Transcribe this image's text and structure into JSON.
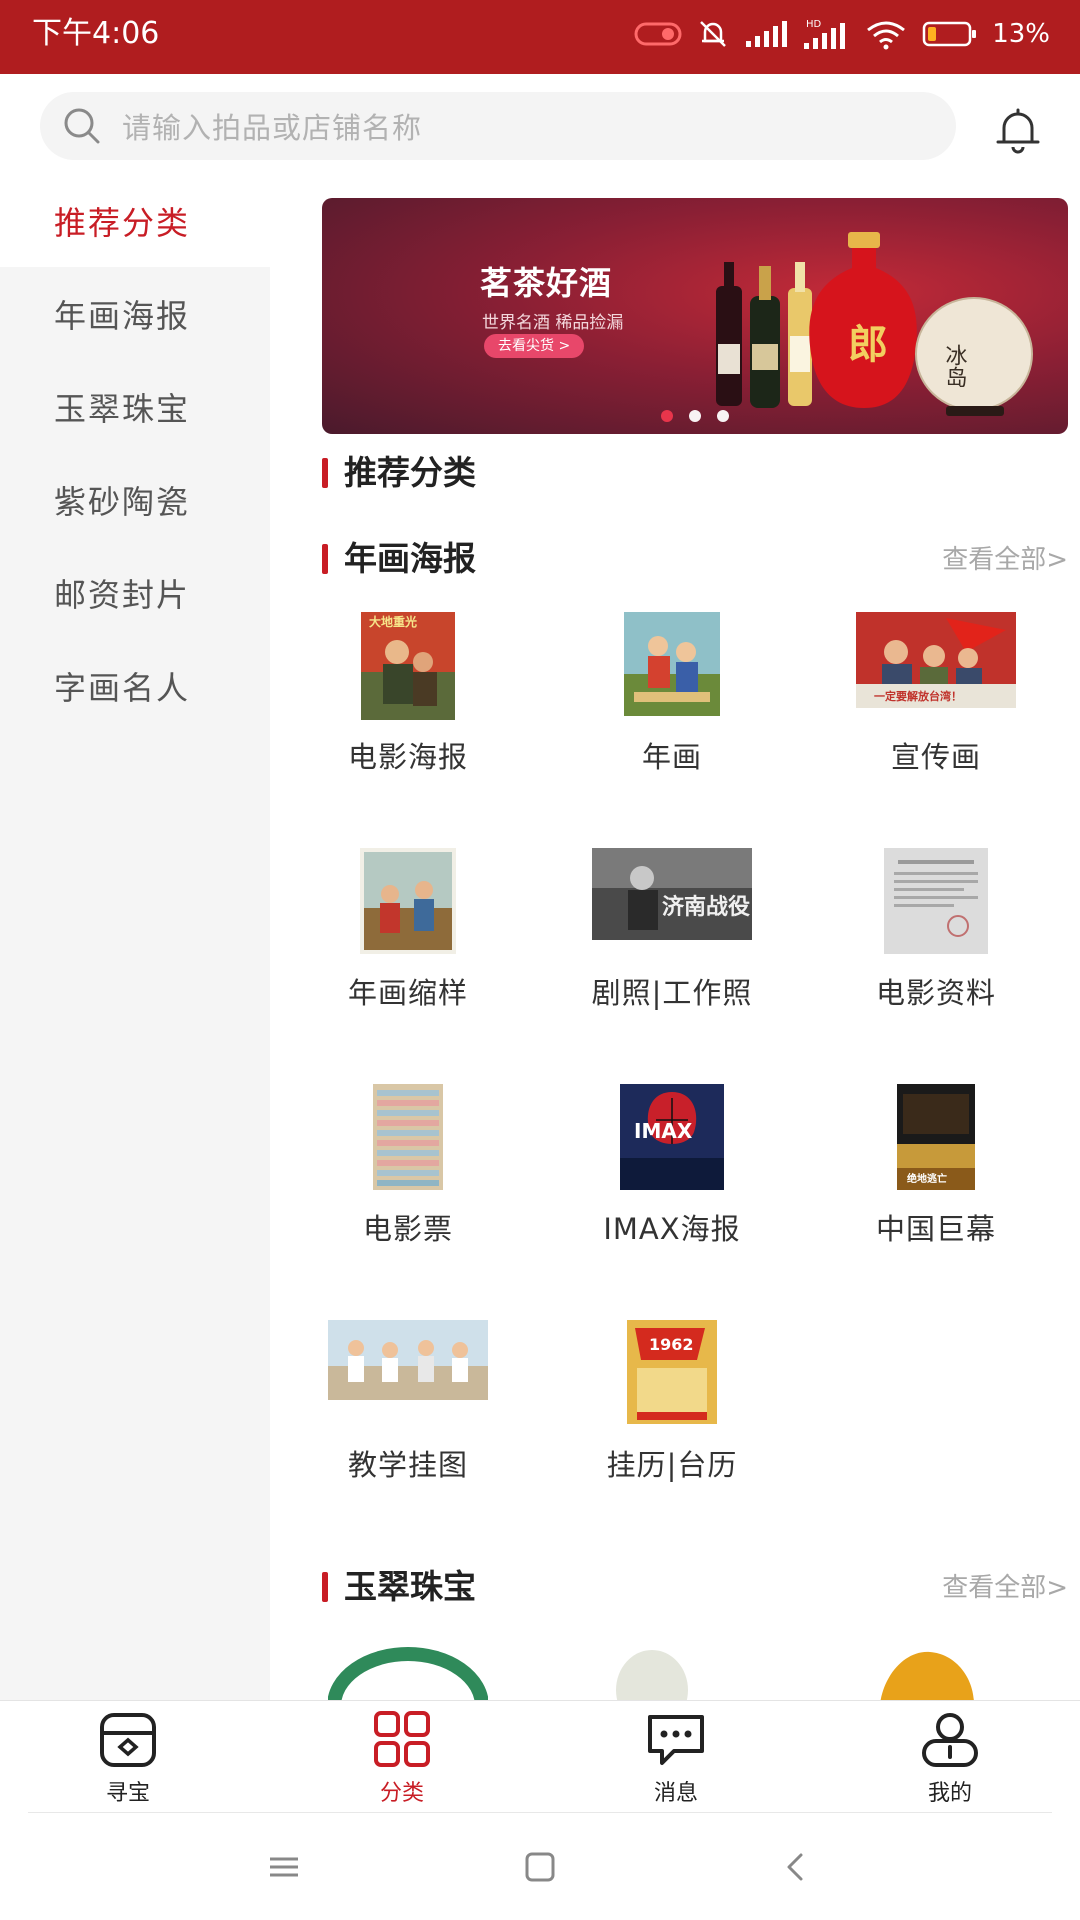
{
  "status_bar": {
    "time": "下午4:06",
    "battery": "13%",
    "hd_label": "HD"
  },
  "search": {
    "placeholder": "请输入拍品或店铺名称"
  },
  "sidebar": {
    "items": [
      {
        "label": "推荐分类",
        "active": true
      },
      {
        "label": "年画海报",
        "active": false
      },
      {
        "label": "玉翠珠宝",
        "active": false
      },
      {
        "label": "紫砂陶瓷",
        "active": false
      },
      {
        "label": "邮资封片",
        "active": false
      },
      {
        "label": "字画名人",
        "active": false
      }
    ]
  },
  "banner": {
    "title": "茗茶好酒",
    "subtitle": "世界名酒 稀品捡漏",
    "button": "去看尖货 >",
    "tea_text": "冰岛",
    "bottle_text": "郎",
    "active_dot": 0,
    "dot_count": 3
  },
  "sections": {
    "recommended": {
      "title": "推荐分类"
    },
    "posters": {
      "title": "年画海报",
      "more": "查看全部>",
      "items": [
        {
          "label": "电影海报",
          "thumb_text": "大地重光"
        },
        {
          "label": "年画"
        },
        {
          "label": "宣传画",
          "thumb_text": "一定要解放台湾！"
        },
        {
          "label": "年画缩样"
        },
        {
          "label": "剧照|工作照",
          "thumb_text": "济南战役"
        },
        {
          "label": "电影资料"
        },
        {
          "label": "电影票"
        },
        {
          "label": "IMAX海报",
          "thumb_text": "IMAX"
        },
        {
          "label": "中国巨幕",
          "thumb_text": "绝地逃亡"
        },
        {
          "label": "教学挂图"
        },
        {
          "label": "挂历|台历",
          "thumb_text": "1962"
        }
      ]
    },
    "jewelry": {
      "title": "玉翠珠宝",
      "more": "查看全部>"
    }
  },
  "bottom_nav": {
    "items": [
      {
        "label": "寻宝",
        "icon": "treasure-icon",
        "active": false
      },
      {
        "label": "分类",
        "icon": "category-grid-icon",
        "active": true
      },
      {
        "label": "消息",
        "icon": "message-icon",
        "active": false
      },
      {
        "label": "我的",
        "icon": "profile-icon",
        "active": false
      }
    ]
  },
  "colors": {
    "brand_red": "#c81d25",
    "status_bar": "#b01d1f",
    "sidebar_bg": "#f5f5f5"
  }
}
